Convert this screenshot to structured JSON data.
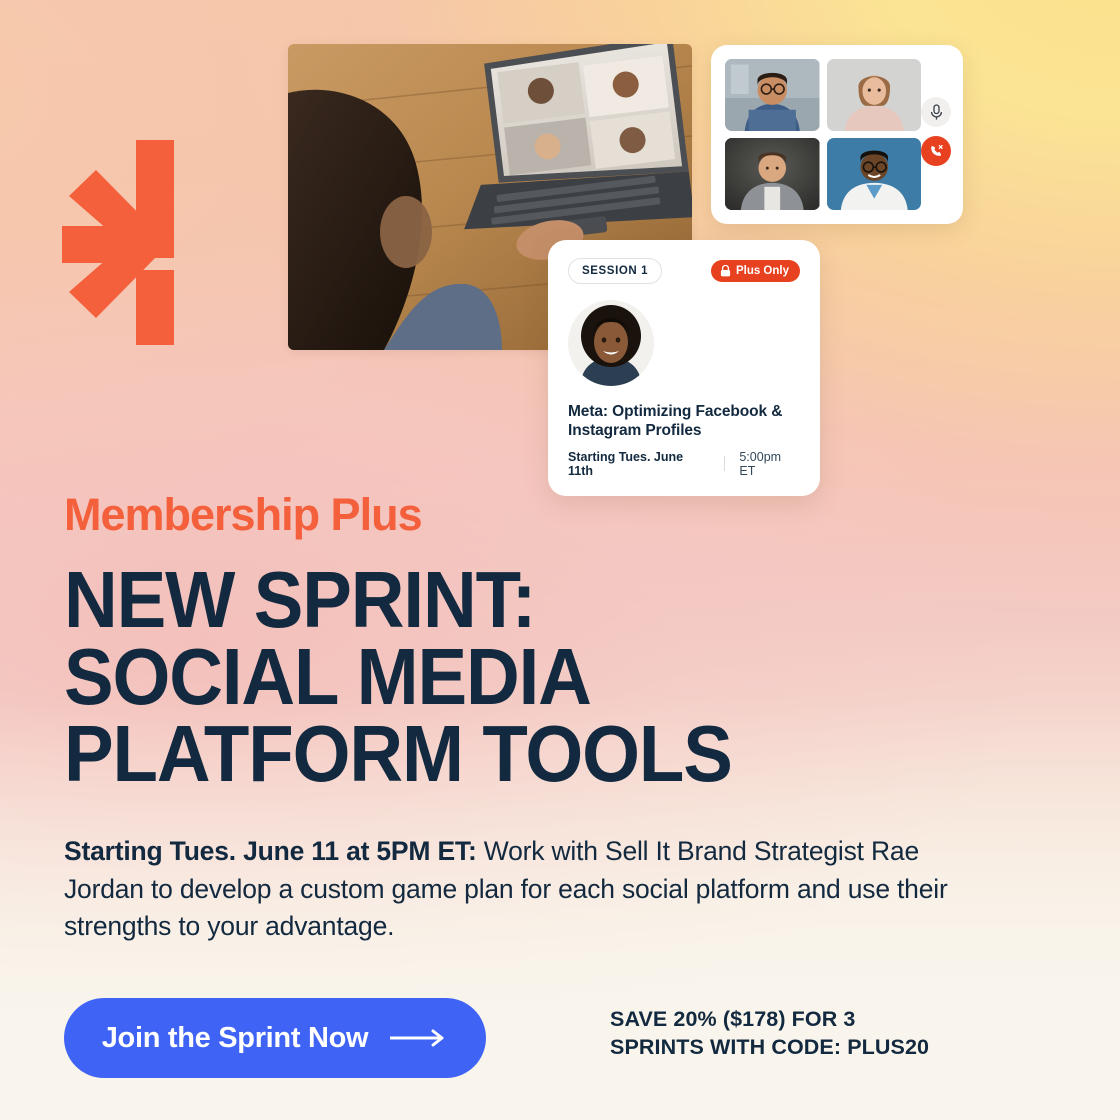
{
  "colors": {
    "accent_orange": "#F4603C",
    "badge_red": "#E8411F",
    "navy": "#12293F",
    "cta_blue": "#3F63F5",
    "card_white": "#FFFFFF",
    "bg_peach": "#F5C5A8",
    "bg_yellow": "#FBE08C",
    "bg_pink": "#F5C4BC",
    "bg_cream": "#F9F5EC"
  },
  "brand": {
    "logo_name": "arrow-chevron-logo"
  },
  "hero_photo": {
    "alt": "person on laptop video call at wooden desk"
  },
  "video_panel": {
    "participants": [
      {
        "name": "participant-1"
      },
      {
        "name": "participant-2"
      },
      {
        "name": "participant-3"
      },
      {
        "name": "participant-4"
      }
    ],
    "controls": [
      {
        "name": "microphone-button",
        "icon": "microphone-icon"
      },
      {
        "name": "end-call-button",
        "icon": "phone-hangup-icon"
      }
    ]
  },
  "session_card": {
    "session_pill": "SESSION 1",
    "plus_badge": "Plus Only",
    "plus_badge_icon": "lock-icon",
    "speaker_avatar": "speaker-headshot",
    "title": "Meta: Optimizing Facebook & Instagram Profiles",
    "start_date": "Starting Tues. June 11th",
    "start_time": "5:00pm ET"
  },
  "hero": {
    "eyebrow": "Membership Plus",
    "headline_line_1": "NEW SPRINT:",
    "headline_line_2": "SOCIAL MEDIA",
    "headline_line_3": "PLATFORM TOOLS",
    "body_lead": "Starting Tues. June 11 at 5PM ET:",
    "body_rest": " Work with Sell It Brand Strategist Rae Jordan to develop a custom game plan for each social platform and use their strengths to your advantage."
  },
  "cta": {
    "label": "Join the Sprint Now",
    "arrow_icon": "arrow-right-icon",
    "promo_line_1": "SAVE 20% ($178) FOR 3",
    "promo_line_2": "SPRINTS WITH CODE: PLUS20"
  }
}
